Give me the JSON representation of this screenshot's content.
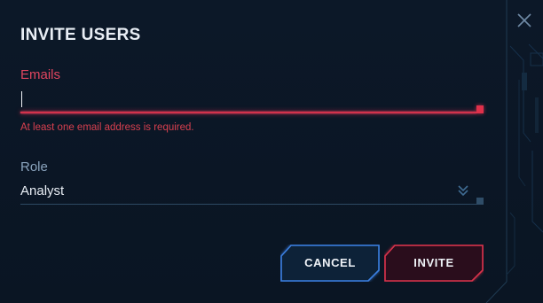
{
  "dialog": {
    "title": "INVITE USERS",
    "emails": {
      "label": "Emails",
      "value": "",
      "error": "At least one email address is required."
    },
    "role": {
      "label": "Role",
      "value": "Analyst"
    },
    "buttons": {
      "cancel": "CANCEL",
      "invite": "INVITE"
    }
  },
  "icons": {
    "close": "close-icon",
    "chevron": "double-chevron-down-icon"
  },
  "colors": {
    "background": "#0b1626",
    "error_accent": "#e0455f",
    "primary_blue": "#3b7fe0",
    "muted_label": "#8aa3bd",
    "text": "#e9eef5"
  }
}
